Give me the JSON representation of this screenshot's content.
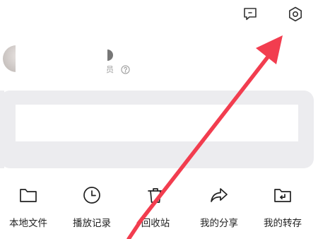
{
  "header": {
    "feedback_icon": "message-square-icon",
    "settings_icon": "gear-icon"
  },
  "profile": {
    "member_text": "员",
    "help_icon": "question-circle-icon"
  },
  "shortcuts": [
    {
      "label": "本地文件",
      "icon": "folder-icon"
    },
    {
      "label": "播放记录",
      "icon": "clock-icon"
    },
    {
      "label": "回收站",
      "icon": "trash-icon"
    },
    {
      "label": "我的分享",
      "icon": "share-arrow-icon"
    },
    {
      "label": "我的转存",
      "icon": "folder-import-icon"
    }
  ],
  "annotation": {
    "arrow_color": "#f23d4f"
  }
}
